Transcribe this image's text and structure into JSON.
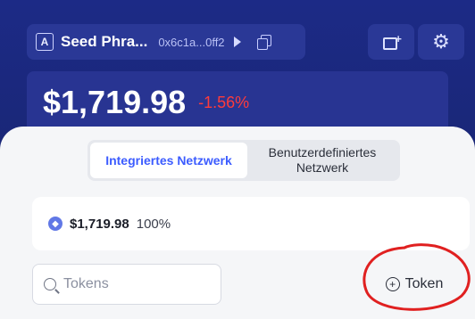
{
  "header": {
    "wallet_badge": "A",
    "account_name": "Seed Phra...",
    "account_address": "0x6c1a...0ff2"
  },
  "balance": {
    "value": "$1,719.98",
    "change": "-1.56%"
  },
  "tabs": {
    "active_label": "Integriertes Netzwerk",
    "inactive_label": "Benutzerdefiniertes Netzwerk"
  },
  "asset": {
    "amount": "$1,719.98",
    "percent": "100%"
  },
  "search": {
    "placeholder": "Tokens",
    "value": ""
  },
  "token_button": {
    "label": "Token"
  },
  "colors": {
    "header_bg": "#1c2a86",
    "accent": "#3c5cff",
    "negative": "#ff3b3b",
    "annotation": "#e02020"
  }
}
